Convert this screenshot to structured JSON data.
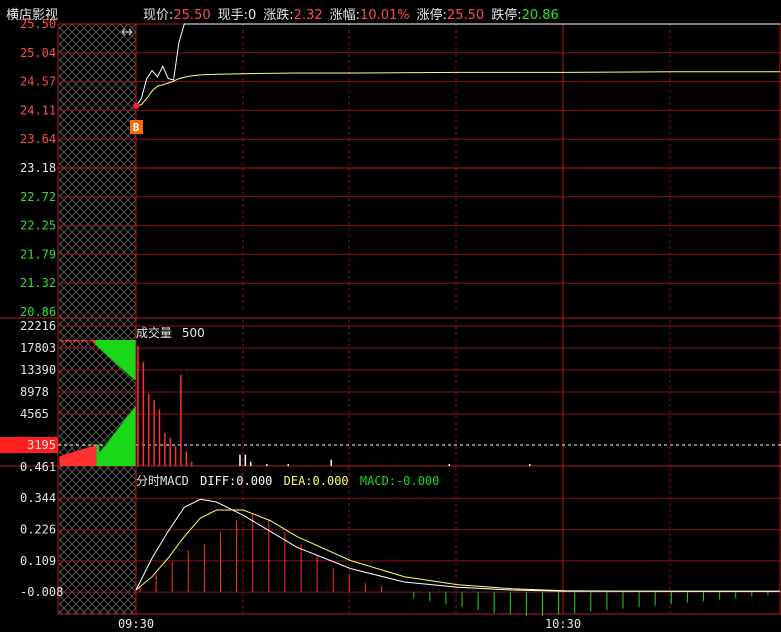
{
  "header": {
    "stock_name": "横店影视",
    "quote": [
      {
        "label": "现价:",
        "value": "25.50",
        "color": "#ff4d4d"
      },
      {
        "label": "现手:",
        "value": "0",
        "color": "#e6e6e6"
      },
      {
        "label": "涨跌:",
        "value": "2.32",
        "color": "#ff4d4d"
      },
      {
        "label": "涨幅:",
        "value": "10.01%",
        "color": "#ff4d4d"
      },
      {
        "label": "涨停:",
        "value": "25.50",
        "color": "#ff4d4d"
      },
      {
        "label": "跌停:",
        "value": "20.86",
        "color": "#2ee12e"
      }
    ]
  },
  "price_panel": {
    "y_labels": [
      "25.50",
      "25.04",
      "24.57",
      "24.11",
      "23.64",
      "23.18",
      "22.72",
      "22.25",
      "21.79",
      "21.32",
      "20.86"
    ],
    "y_label_colors": [
      "#ff4d4d",
      "#ff4d4d",
      "#ff4d4d",
      "#ff4d4d",
      "#ff4d4d",
      "#e6e6e6",
      "#2ee12e",
      "#2ee12e",
      "#2ee12e",
      "#2ee12e",
      "#2ee12e"
    ],
    "buy_marker": "B",
    "resize_icon": "resize-arrows-icon"
  },
  "volume_panel": {
    "title": "成交量",
    "title_value": "500",
    "y_labels": [
      "22216",
      "17803",
      "13390",
      "8978",
      "4565"
    ],
    "current_volume": "3195"
  },
  "macd_panel": {
    "title": "分时MACD",
    "diff": "DIFF:0.000",
    "dea": "DEA:0.000",
    "macd": "MACD:-0.000",
    "y_labels": [
      "0.461",
      "0.344",
      "0.226",
      "0.109",
      "-0.008"
    ]
  },
  "time_axis": {
    "labels": [
      "09:30",
      "10:30"
    ]
  },
  "colors": {
    "grid": "#8a1515",
    "axis": "#b01e1e",
    "price_line": "#ffffff",
    "avg_line": "#ffff80",
    "up": "#ff3030",
    "down": "#19d819",
    "diff": "#ffffff",
    "dea": "#ffff60"
  },
  "chart_data": [
    {
      "type": "line",
      "title": "",
      "series": [
        {
          "name": "",
          "x": [
            0,
            1,
            2,
            3,
            4,
            5,
            6,
            7,
            8,
            9,
            10,
            11,
            12,
            15,
            20,
            30,
            40,
            60,
            80,
            100,
            120
          ],
          "values": [
            24.18,
            24.3,
            24.62,
            24.75,
            24.65,
            24.82,
            24.62,
            24.6,
            25.2,
            25.5,
            25.5,
            25.5,
            25.5,
            25.5,
            25.5,
            25.5,
            25.5,
            25.5,
            25.5,
            25.5,
            25.5
          ]
        },
        {
          "name": "",
          "x": [
            0,
            1,
            2,
            3,
            4,
            5,
            6,
            7,
            8,
            9,
            10,
            12,
            15,
            20,
            30,
            40,
            60,
            80,
            100,
            120
          ],
          "values": [
            24.18,
            24.2,
            24.3,
            24.42,
            24.5,
            24.52,
            24.55,
            24.58,
            24.62,
            24.64,
            24.66,
            24.68,
            24.69,
            24.7,
            24.71,
            24.71,
            24.72,
            24.72,
            24.73,
            24.73
          ]
        }
      ],
      "ylim": [
        20.86,
        25.5
      ],
      "grid": true
    },
    {
      "type": "bar",
      "title": "",
      "ylim": [
        0,
        22216
      ],
      "bars": [
        {
          "x": 0,
          "value": 19000,
          "dir": "up"
        },
        {
          "x": 1,
          "value": 16500,
          "dir": "up"
        },
        {
          "x": 2,
          "value": 11500,
          "dir": "up"
        },
        {
          "x": 3,
          "value": 10500,
          "dir": "up"
        },
        {
          "x": 4,
          "value": 9000,
          "dir": "up"
        },
        {
          "x": 5,
          "value": 5200,
          "dir": "up"
        },
        {
          "x": 6,
          "value": 4500,
          "dir": "up"
        },
        {
          "x": 7,
          "value": 3200,
          "dir": "up"
        },
        {
          "x": 8,
          "value": 14500,
          "dir": "up"
        },
        {
          "x": 9,
          "value": 2300,
          "dir": "up"
        },
        {
          "x": 10,
          "value": 700,
          "dir": "up"
        },
        {
          "x": 19,
          "value": 1800,
          "dir": "flat"
        },
        {
          "x": 20,
          "value": 1800,
          "dir": "flat"
        },
        {
          "x": 21,
          "value": 700,
          "dir": "flat"
        },
        {
          "x": 24,
          "value": 300,
          "dir": "flat"
        },
        {
          "x": 28,
          "value": 300,
          "dir": "flat"
        },
        {
          "x": 36,
          "value": 1000,
          "dir": "flat"
        },
        {
          "x": 58,
          "value": 300,
          "dir": "flat"
        },
        {
          "x": 73,
          "value": 300,
          "dir": "flat"
        }
      ]
    },
    {
      "type": "line",
      "title": "",
      "ylim": [
        -0.06,
        0.461
      ],
      "diff": {
        "x": [
          0,
          3,
          6,
          9,
          12,
          15,
          20,
          25,
          30,
          40,
          50,
          60,
          70,
          80,
          90,
          100,
          110,
          120
        ],
        "values": [
          0.0,
          0.12,
          0.22,
          0.31,
          0.34,
          0.33,
          0.28,
          0.22,
          0.16,
          0.08,
          0.03,
          0.01,
          0.0,
          -0.005,
          -0.005,
          -0.005,
          -0.005,
          -0.005
        ]
      },
      "dea": {
        "x": [
          0,
          3,
          6,
          9,
          12,
          15,
          20,
          25,
          30,
          40,
          50,
          60,
          70,
          80,
          90,
          100,
          110,
          120
        ],
        "values": [
          0.0,
          0.05,
          0.12,
          0.2,
          0.27,
          0.3,
          0.3,
          0.26,
          0.2,
          0.11,
          0.05,
          0.02,
          0.005,
          -0.003,
          -0.004,
          -0.005,
          -0.005,
          -0.005
        ]
      },
      "macd_bars": {
        "x_start": 0,
        "step": 1,
        "values": [
          0.02,
          0.06,
          0.1,
          0.14,
          0.16,
          0.2,
          0.24,
          0.26,
          0.24,
          0.2,
          0.16,
          0.12,
          0.08,
          0.06,
          0.03,
          0.02,
          0.0,
          -0.02,
          -0.03,
          -0.04,
          -0.05,
          -0.06,
          -0.07,
          -0.075,
          -0.08,
          -0.08,
          -0.075,
          -0.07,
          -0.065,
          -0.06,
          -0.055,
          -0.05,
          -0.045,
          -0.04,
          -0.035,
          -0.03,
          -0.025,
          -0.02,
          -0.015,
          -0.01,
          -0.005
        ]
      }
    }
  ]
}
